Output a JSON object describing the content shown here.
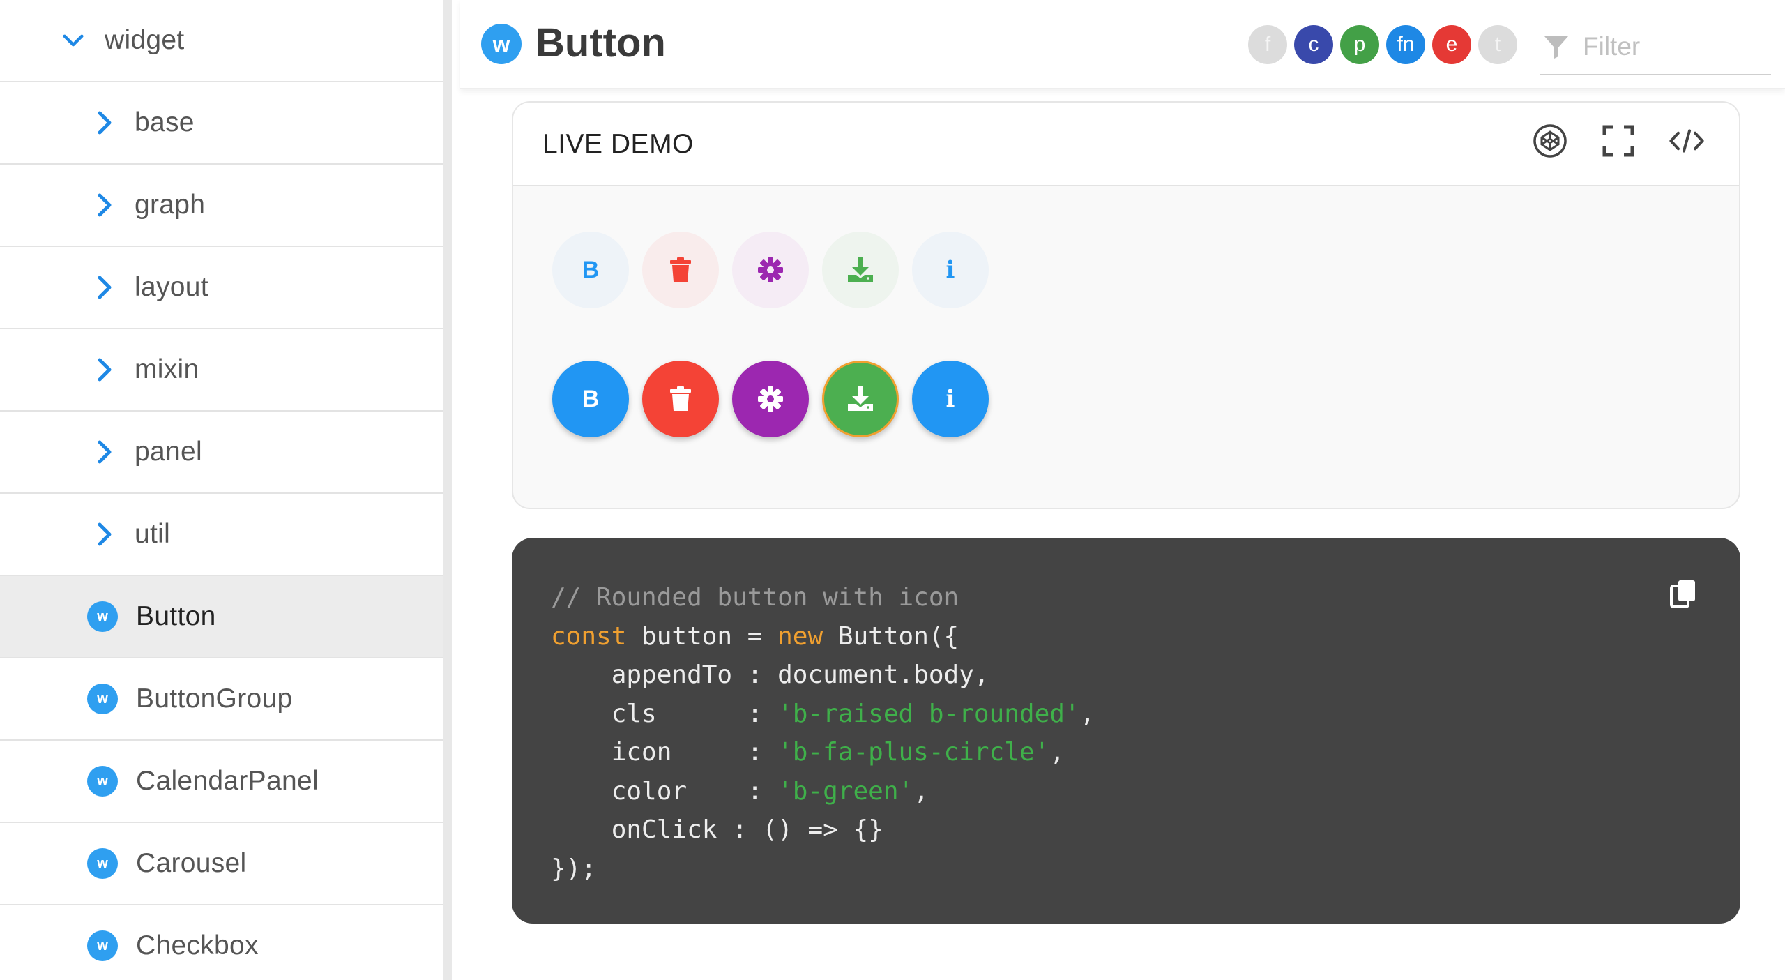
{
  "sidebar": {
    "root": {
      "label": "widget",
      "icon": "chevron-down-icon"
    },
    "folders": [
      {
        "label": "base",
        "icon": "chevron-right-icon"
      },
      {
        "label": "graph",
        "icon": "chevron-right-icon"
      },
      {
        "label": "layout",
        "icon": "chevron-right-icon"
      },
      {
        "label": "mixin",
        "icon": "chevron-right-icon"
      },
      {
        "label": "panel",
        "icon": "chevron-right-icon"
      },
      {
        "label": "util",
        "icon": "chevron-right-icon"
      }
    ],
    "leaves": [
      {
        "label": "Button",
        "badge": "w",
        "selected": true
      },
      {
        "label": "ButtonGroup",
        "badge": "w"
      },
      {
        "label": "CalendarPanel",
        "badge": "w"
      },
      {
        "label": "Carousel",
        "badge": "w"
      },
      {
        "label": "Checkbox",
        "badge": "w"
      }
    ]
  },
  "header": {
    "logo": "w",
    "title": "Button",
    "pills": [
      {
        "label": "f",
        "color": "#dcdcdc",
        "text_color": "#f5f5f5"
      },
      {
        "label": "c",
        "color": "#3949ab",
        "text_color": "#ffffff"
      },
      {
        "label": "p",
        "color": "#43a047",
        "text_color": "#ffffff"
      },
      {
        "label": "fn",
        "color": "#1e88e5",
        "text_color": "#ffffff"
      },
      {
        "label": "e",
        "color": "#e53935",
        "text_color": "#ffffff"
      },
      {
        "label": "t",
        "color": "#dcdcdc",
        "text_color": "#f5f5f5"
      }
    ],
    "filter": {
      "placeholder": "Filter",
      "value": "",
      "icon": "filter-icon"
    }
  },
  "demo": {
    "title": "LIVE DEMO",
    "toolbar": [
      "codepen-icon",
      "fullscreen-icon",
      "code-icon"
    ],
    "light_buttons": [
      {
        "kind": "text",
        "text": "B",
        "color": "#2196f3",
        "bg": "#eef3f8"
      },
      {
        "kind": "icon",
        "icon": "trash-icon",
        "color": "#f44336",
        "bg": "#f9ecec"
      },
      {
        "kind": "icon",
        "icon": "gear-icon",
        "color": "#9c27b0",
        "bg": "#f5ecf5"
      },
      {
        "kind": "icon",
        "icon": "download-icon",
        "color": "#4caf50",
        "bg": "#eef4ee"
      },
      {
        "kind": "text",
        "text": "i",
        "color": "#2196f3",
        "bg": "#eef3f8"
      }
    ],
    "solid_buttons": [
      {
        "kind": "text",
        "text": "B",
        "bg": "#2196f3"
      },
      {
        "kind": "icon",
        "icon": "trash-icon",
        "bg": "#f44336"
      },
      {
        "kind": "icon",
        "icon": "gear-icon",
        "bg": "#9c27b0"
      },
      {
        "kind": "icon",
        "icon": "download-icon",
        "bg": "#4caf50",
        "focused": true,
        "ring": "#f0a030"
      },
      {
        "kind": "text",
        "text": "i",
        "bg": "#2196f3"
      }
    ]
  },
  "code": {
    "copy_icon": "copy-icon",
    "lines": [
      [
        {
          "t": "// Rounded button with icon",
          "c": "com"
        }
      ],
      [
        {
          "t": "const",
          "c": "kw"
        },
        {
          "t": " button = ",
          "c": ""
        },
        {
          "t": "new",
          "c": "kw"
        },
        {
          "t": " Button({",
          "c": ""
        }
      ],
      [
        {
          "t": "    appendTo : document.body,",
          "c": ""
        }
      ],
      [
        {
          "t": "    cls      : ",
          "c": ""
        },
        {
          "t": "'b-raised b-rounded'",
          "c": "str"
        },
        {
          "t": ",",
          "c": ""
        }
      ],
      [
        {
          "t": "    icon     : ",
          "c": ""
        },
        {
          "t": "'b-fa-plus-circle'",
          "c": "str"
        },
        {
          "t": ",",
          "c": ""
        }
      ],
      [
        {
          "t": "    color    : ",
          "c": ""
        },
        {
          "t": "'b-green'",
          "c": "str"
        },
        {
          "t": ",",
          "c": ""
        }
      ],
      [
        {
          "t": "    onClick : () => {}",
          "c": ""
        }
      ],
      [
        {
          "t": "});",
          "c": ""
        }
      ]
    ]
  }
}
